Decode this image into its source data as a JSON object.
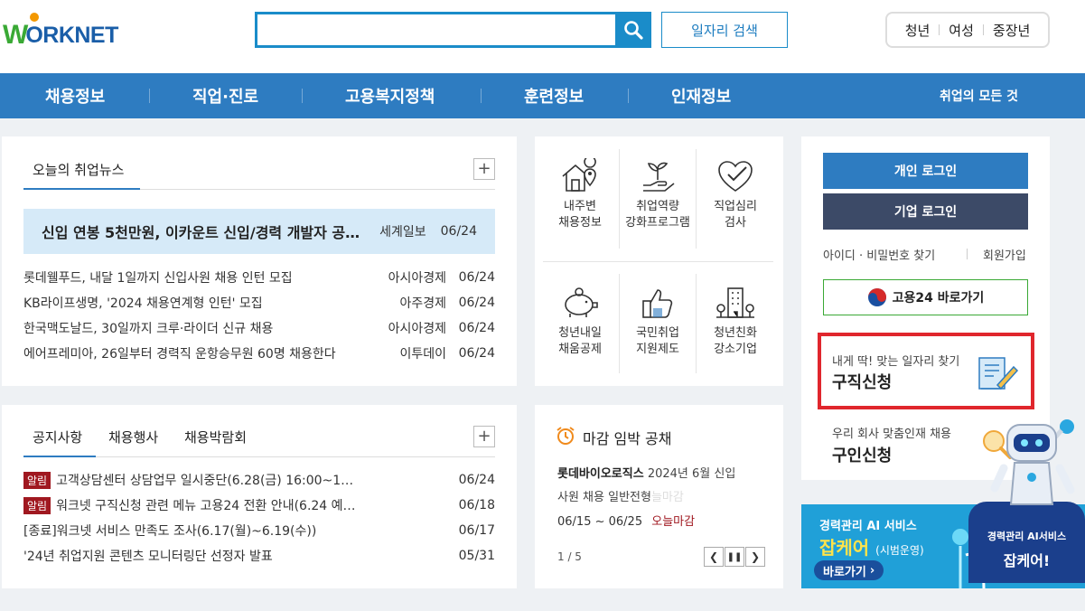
{
  "header": {
    "logo_text_w": "W",
    "logo_text_rest": "ORKNET",
    "search_placeholder": "",
    "job_search_label": "일자리 검색",
    "quick_links": [
      "청년",
      "여성",
      "중장년"
    ]
  },
  "nav": {
    "items": [
      "채용정보",
      "직업·진로",
      "고용복지정책",
      "훈련정보",
      "인재정보"
    ],
    "all_label": "취업의 모든 것"
  },
  "news": {
    "tab": "오늘의 취업뉴스",
    "headline": {
      "title": "신입 연봉 5천만원, 이카운트 신입/경력 개발자 공…",
      "source": "세계일보",
      "date": "06/24"
    },
    "items": [
      {
        "title": "롯데웰푸드, 내달 1일까지 신입사원 채용 인턴 모집",
        "source": "아시아경제",
        "date": "06/24"
      },
      {
        "title": "KB라이프생명, '2024 채용연계형 인턴' 모집",
        "source": "아주경제",
        "date": "06/24"
      },
      {
        "title": "한국맥도날드, 30일까지 크루·라이더 신규 채용",
        "source": "아시아경제",
        "date": "06/24"
      },
      {
        "title": "에어프레미아, 26일부터 경력직 운항승무원 60명 채용한다",
        "source": "이투데이",
        "date": "06/24"
      }
    ]
  },
  "services": [
    {
      "line1": "내주변",
      "line2": "채용정보",
      "icon": "house-location-icon"
    },
    {
      "line1": "취업역량",
      "line2": "강화프로그램",
      "icon": "sprout-hand-icon"
    },
    {
      "line1": "직업심리",
      "line2": "검사",
      "icon": "heart-check-icon"
    },
    {
      "line1": "청년내일",
      "line2": "채움공제",
      "icon": "piggy-bank-icon"
    },
    {
      "line1": "국민취업",
      "line2": "지원제도",
      "icon": "thumbs-up-icon"
    },
    {
      "line1": "청년친화",
      "line2": "강소기업",
      "icon": "building-icon"
    }
  ],
  "notice": {
    "tabs": [
      "공지사항",
      "채용행사",
      "채용박람회"
    ],
    "badge": "알림",
    "items": [
      {
        "badge": true,
        "title": "고객상담센터 상담업무 일시중단(6.28(금) 16:00~1…",
        "date": "06/24"
      },
      {
        "badge": true,
        "title": "워크넷 구직신청 관련 메뉴 고용24 전환 안내(6.24 예…",
        "date": "06/18"
      },
      {
        "badge": false,
        "title": "[종료]워크넷 서비스 만족도 조사(6.17(월)~6.19(수))",
        "date": "06/17"
      },
      {
        "badge": false,
        "title": "'24년 취업지원 콘텐츠 모니터링단 선정자 발표",
        "date": "05/31"
      }
    ]
  },
  "deadline": {
    "title": "마감 임박 공채",
    "company": "롯데바이오로직스",
    "desc": "2024년 6월 신입",
    "desc2": "사원 채용 일반전형",
    "ghost": "늘마감",
    "period": "06/15 ~ 06/25",
    "status": "오늘마감",
    "pager": "1 / 5"
  },
  "login": {
    "personal": "개인 로그인",
    "company": "기업 로그인",
    "find": "아이디 · 비밀번호 찾기",
    "join": "회원가입",
    "go24": "고용24 바로가기"
  },
  "apply": {
    "small": "내게 딱! 맞는 일자리 찾기",
    "big": "구직신청"
  },
  "recruit": {
    "small": "우리 회사 맞춤인재 채용",
    "big": "구인신청"
  },
  "banner": {
    "line1": "경력관리 AI 서비스",
    "line2": "잡케어",
    "line2_suffix": "(시범운영)",
    "go": "바로가기",
    "bubble1": "경력관리 AI서비스",
    "bubble2": "잡케어!"
  },
  "colors": {
    "brand_blue": "#2e7cc1",
    "brand_green": "#3aa935",
    "alert_red": "#a01820",
    "highlight_red": "#e0262d"
  }
}
